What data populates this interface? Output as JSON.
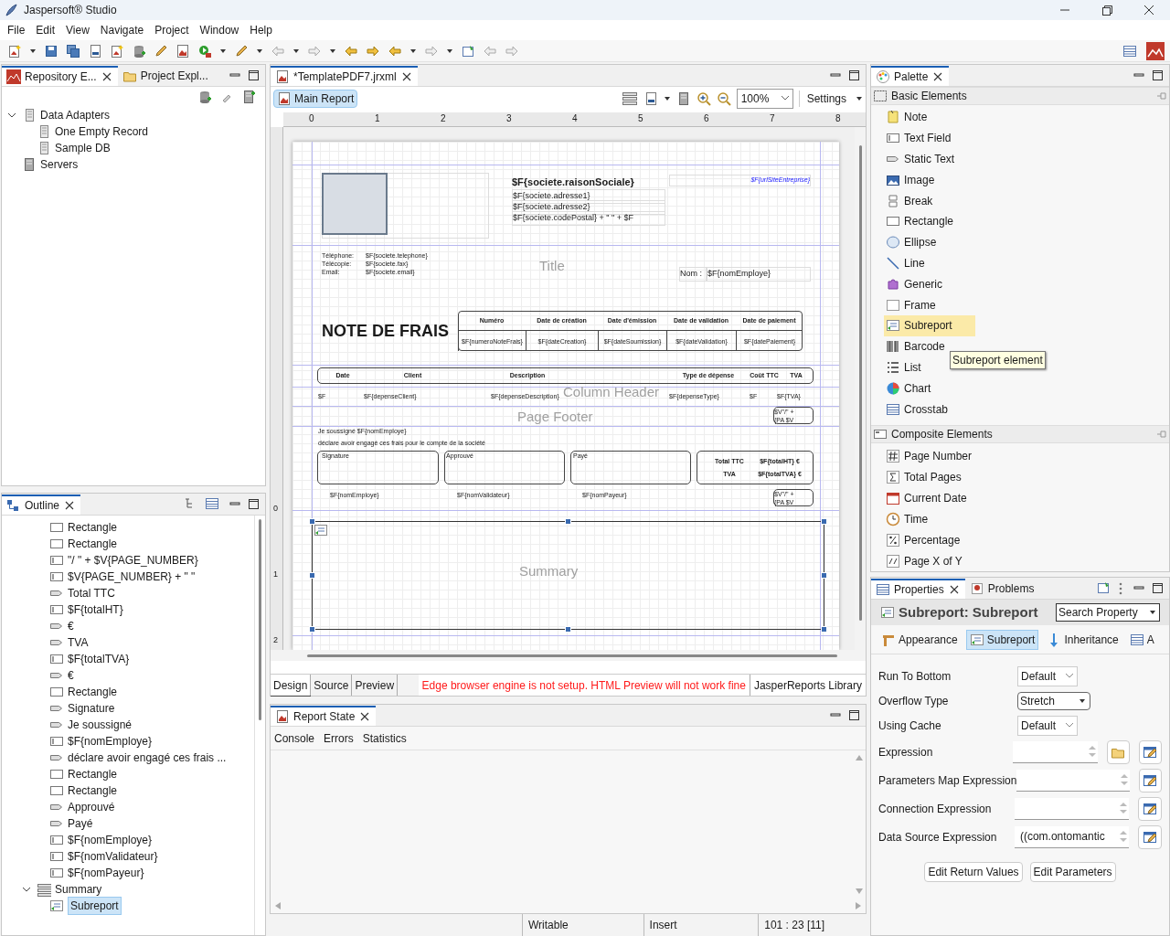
{
  "window": {
    "title": "Jaspersoft® Studio"
  },
  "menu": [
    "File",
    "Edit",
    "View",
    "Navigate",
    "Project",
    "Window",
    "Help"
  ],
  "left_tabs": [
    {
      "label": "Repository E...",
      "selected": true
    },
    {
      "label": "Project Expl...",
      "selected": false
    }
  ],
  "repository_tree": [
    {
      "label": "Data Adapters",
      "expanded": true,
      "children": [
        {
          "label": "One Empty Record"
        },
        {
          "label": "Sample DB"
        }
      ]
    },
    {
      "label": "Servers"
    }
  ],
  "outline": {
    "title": "Outline",
    "items": [
      {
        "kind": "rectangle",
        "label": "Rectangle"
      },
      {
        "kind": "rectangle",
        "label": "Rectangle"
      },
      {
        "kind": "field",
        "label": "\"/ \" + $V{PAGE_NUMBER}"
      },
      {
        "kind": "field",
        "label": "$V{PAGE_NUMBER} + \" \""
      },
      {
        "kind": "label",
        "label": "Total TTC"
      },
      {
        "kind": "field",
        "label": "$F{totalHT}"
      },
      {
        "kind": "label",
        "label": "€"
      },
      {
        "kind": "label",
        "label": "TVA"
      },
      {
        "kind": "field",
        "label": "$F{totalTVA}"
      },
      {
        "kind": "label",
        "label": "€"
      },
      {
        "kind": "rectangle",
        "label": "Rectangle"
      },
      {
        "kind": "label",
        "label": "Signature"
      },
      {
        "kind": "label",
        "label": "Je soussigné"
      },
      {
        "kind": "field",
        "label": "$F{nomEmploye}"
      },
      {
        "kind": "label",
        "label": "déclare avoir engagé ces frais ..."
      },
      {
        "kind": "rectangle",
        "label": "Rectangle"
      },
      {
        "kind": "rectangle",
        "label": "Rectangle"
      },
      {
        "kind": "label",
        "label": "Approuvé"
      },
      {
        "kind": "label",
        "label": "Payé"
      },
      {
        "kind": "field",
        "label": "$F{nomEmploye}"
      },
      {
        "kind": "field",
        "label": "$F{nomValidateur}"
      },
      {
        "kind": "field",
        "label": "$F{nomPayeur}"
      }
    ],
    "band": {
      "label": "Summary",
      "expanded": true,
      "children": [
        {
          "kind": "subreport",
          "label": "Subreport",
          "selected": true
        }
      ]
    }
  },
  "editor": {
    "tab": "*TemplatePDF7.jrxml",
    "main_report": "Main Report",
    "zoom": "100%",
    "settings": "Settings",
    "ruler": [
      "0",
      "1",
      "2",
      "3",
      "4",
      "5",
      "6",
      "7",
      "8"
    ],
    "vertical_ruler": [
      "0",
      "1",
      "2"
    ],
    "report": {
      "bands": [
        "Title",
        "Column Header",
        "Page Footer",
        "Summary"
      ],
      "elements": [
        {
          "kind": "heading",
          "text": "$F{societe.raisonSociale}"
        },
        {
          "kind": "field",
          "text": "$F{societe.adresse1}"
        },
        {
          "kind": "field",
          "text": "$F{societe.adresse2}"
        },
        {
          "kind": "field",
          "text": "$F{societe.codePostal} + \" \" + $F"
        },
        {
          "kind": "link",
          "text": "$F{urlSiteEntreprise}"
        },
        {
          "kind": "small",
          "text": "Téléphone:"
        },
        {
          "kind": "small",
          "text": "Télécopie:"
        },
        {
          "kind": "small",
          "text": "Email:"
        },
        {
          "kind": "small",
          "text": "$F{societe.telephone}"
        },
        {
          "kind": "small",
          "text": "$F{societe.fax}"
        },
        {
          "kind": "small",
          "text": "$F{societe.email}"
        },
        {
          "kind": "field",
          "text": "Nom :"
        },
        {
          "kind": "field",
          "text": "$F{nomEmploye}"
        },
        {
          "kind": "title",
          "text": "NOTE DE FRAIS"
        },
        {
          "kind": "table-head",
          "text": "Numéro"
        },
        {
          "kind": "table-head",
          "text": "Date de création"
        },
        {
          "kind": "table-head",
          "text": "Date d'émission"
        },
        {
          "kind": "table-head",
          "text": "Date de validation"
        },
        {
          "kind": "table-head",
          "text": "Date de paiement"
        },
        {
          "kind": "table-cell",
          "text": "$F{numeroNoteFrais}"
        },
        {
          "kind": "table-cell",
          "text": "$F{dateCreation}"
        },
        {
          "kind": "table-cell",
          "text": "$F{dateSoumission}"
        },
        {
          "kind": "table-cell",
          "text": "$F{dateValidation}"
        },
        {
          "kind": "table-cell",
          "text": "$F{datePaiement}"
        },
        {
          "kind": "table-head",
          "text": "Date"
        },
        {
          "kind": "table-head",
          "text": "Client"
        },
        {
          "kind": "table-head",
          "text": "Description"
        },
        {
          "kind": "table-head",
          "text": "Type de dépense"
        },
        {
          "kind": "table-head",
          "text": "Coût TTC"
        },
        {
          "kind": "table-head",
          "text": "TVA"
        },
        {
          "kind": "small",
          "text": "$F"
        },
        {
          "kind": "small",
          "text": "$F{depenseClient}"
        },
        {
          "kind": "small",
          "text": "$F{depenseDescription}"
        },
        {
          "kind": "small",
          "text": "$F{depenseType}"
        },
        {
          "kind": "small",
          "text": "$F"
        },
        {
          "kind": "small",
          "text": "$F{TVA}"
        },
        {
          "kind": "small",
          "text": "$V\"/\" +"
        },
        {
          "kind": "small",
          "text": "{PA  $V"
        },
        {
          "kind": "small",
          "text": "Je soussigné $F{nomEmploye}"
        },
        {
          "kind": "small",
          "text": "déclare avoir engagé ces frais pour le compte de la société"
        },
        {
          "kind": "small",
          "text": "Signature"
        },
        {
          "kind": "small",
          "text": "Approuvé"
        },
        {
          "kind": "small",
          "text": "Payé"
        },
        {
          "kind": "table-head",
          "text": "Total TTC"
        },
        {
          "kind": "table-head",
          "text": "$F{totalHT} €"
        },
        {
          "kind": "table-head",
          "text": "TVA"
        },
        {
          "kind": "table-head",
          "text": "$F{totalTVA} €"
        },
        {
          "kind": "small",
          "text": "$F{nomEmploye}"
        },
        {
          "kind": "small",
          "text": "$F{nomValidateur}"
        },
        {
          "kind": "small",
          "text": "$F{nomPayeur}"
        },
        {
          "kind": "small",
          "text": "$V\"/\" +"
        },
        {
          "kind": "small",
          "text": "{PA  $V"
        }
      ]
    },
    "view_tabs": [
      {
        "label": "Design",
        "selected": true
      },
      {
        "label": "Source",
        "selected": false
      },
      {
        "label": "Preview",
        "selected": false
      }
    ],
    "warning": "Edge browser engine is not setup. HTML Preview will not work fine",
    "library": "JasperReports Library"
  },
  "report_state": {
    "title": "Report State",
    "tabs": [
      "Console",
      "Errors",
      "Statistics"
    ]
  },
  "status_bar": [
    "Writable",
    "Insert",
    "101 : 23 [11]"
  ],
  "palette": {
    "title": "Palette",
    "groups": [
      {
        "label": "Basic Elements",
        "items": [
          {
            "label": "Note",
            "selected": false
          },
          {
            "label": "Text Field",
            "selected": false
          },
          {
            "label": "Static Text",
            "selected": false
          },
          {
            "label": "Image",
            "selected": false
          },
          {
            "label": "Break",
            "selected": false
          },
          {
            "label": "Rectangle",
            "selected": false
          },
          {
            "label": "Ellipse",
            "selected": false
          },
          {
            "label": "Line",
            "selected": false
          },
          {
            "label": "Generic",
            "selected": false
          },
          {
            "label": "Frame",
            "selected": false
          },
          {
            "label": "Subreport",
            "selected": true
          },
          {
            "label": "Barcode",
            "selected": false
          },
          {
            "label": "List",
            "selected": false
          },
          {
            "label": "Chart",
            "selected": false
          },
          {
            "label": "Crosstab",
            "selected": false
          }
        ]
      },
      {
        "label": "Composite Elements",
        "items": [
          {
            "label": "Page Number",
            "selected": false
          },
          {
            "label": "Total Pages",
            "selected": false
          },
          {
            "label": "Current Date",
            "selected": false
          },
          {
            "label": "Time",
            "selected": false
          },
          {
            "label": "Percentage",
            "selected": false
          },
          {
            "label": "Page X of Y",
            "selected": false
          }
        ]
      }
    ],
    "tooltip": "Subreport element"
  },
  "properties": {
    "tabs": [
      {
        "label": "Properties",
        "selected": true
      },
      {
        "label": "Problems",
        "selected": false
      }
    ],
    "heading": "Subreport: Subreport",
    "search": "Search Property",
    "sections": [
      {
        "label": "Appearance",
        "selected": false
      },
      {
        "label": "Subreport",
        "selected": true
      },
      {
        "label": "Inheritance",
        "selected": false
      },
      {
        "label": "A",
        "selected": false
      }
    ],
    "rows": [
      {
        "kind": "combo",
        "label": "Run To Bottom",
        "value": "Default"
      },
      {
        "kind": "dropdown",
        "label": "Overflow Type",
        "value": "Stretch"
      },
      {
        "kind": "combo",
        "label": "Using Cache",
        "value": "Default"
      },
      {
        "kind": "file-expression",
        "label": "Expression"
      },
      {
        "kind": "expression",
        "label": "Parameters Map Expression"
      },
      {
        "kind": "expression",
        "label": "Connection Expression"
      },
      {
        "kind": "expression",
        "label": "Data Source Expression",
        "value": "((com.ontomantic"
      }
    ],
    "buttons": [
      "Edit Return Values",
      "Edit Parameters"
    ]
  }
}
